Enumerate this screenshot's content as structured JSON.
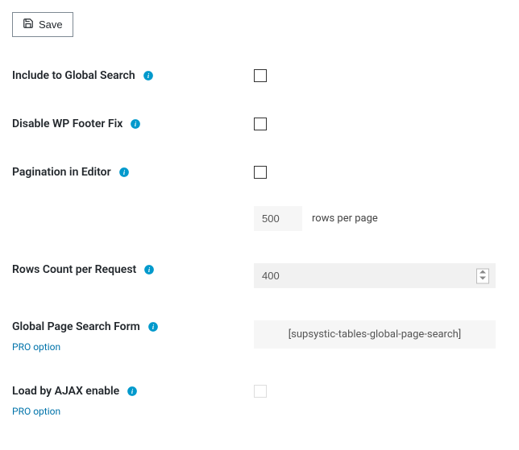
{
  "toolbar": {
    "save_label": "Save"
  },
  "sections": {
    "include_global_search": {
      "label": "Include to Global Search"
    },
    "disable_wp_footer": {
      "label": "Disable WP Footer Fix"
    },
    "pagination_editor": {
      "label": "Pagination in Editor",
      "rows_value": "500",
      "rows_suffix": "rows per page"
    },
    "rows_count": {
      "label": "Rows Count per Request",
      "value": "400"
    },
    "global_page_search": {
      "label": "Global Page Search Form",
      "pro": "PRO option",
      "value": "[supsystic-tables-global-page-search]"
    },
    "load_ajax": {
      "label": "Load by AJAX enable",
      "pro": "PRO option"
    }
  }
}
